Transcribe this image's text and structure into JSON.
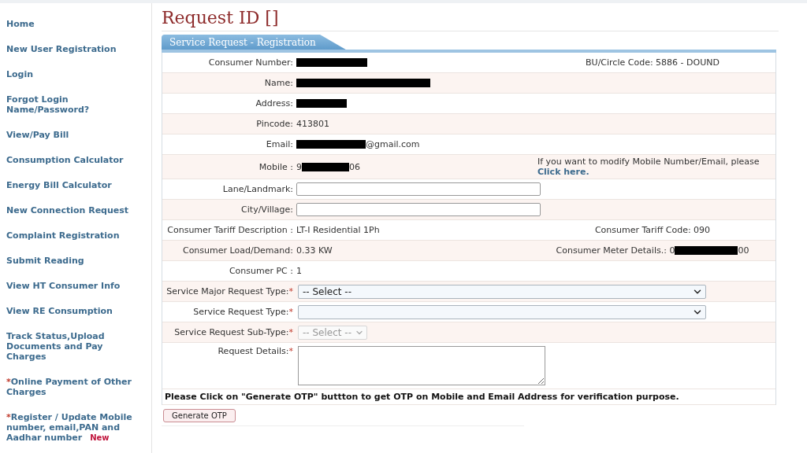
{
  "sidebar": {
    "items": [
      {
        "label": "Home"
      },
      {
        "label": "New User Registration"
      },
      {
        "label": "Login"
      },
      {
        "label": "Forgot Login Name/Password?"
      },
      {
        "label": "View/Pay Bill"
      },
      {
        "label": "Consumption Calculator"
      },
      {
        "label": "Energy Bill Calculator"
      },
      {
        "label": "New Connection Request"
      },
      {
        "label": "Complaint Registration"
      },
      {
        "label": "Submit Reading"
      },
      {
        "label": "View HT Consumer Info"
      },
      {
        "label": "View RE Consumption"
      },
      {
        "label": "Track Status,Upload Documents and Pay Charges"
      },
      {
        "mark": "*",
        "label": "Online Payment of Other Charges"
      },
      {
        "mark": "*",
        "label": "Register / Update Mobile number, email,PAN and Aadhar number",
        "badge": "New"
      }
    ]
  },
  "title": "Request ID []",
  "panel": {
    "tab": "Service Request - Registration",
    "rows": [
      {
        "kind": "text",
        "label": "Consumer Number:",
        "value": [
          {
            "kind": "redaction"
          }
        ],
        "aside": [
          {
            "kind": "text",
            "text": "BU/Circle Code: 5886 - DOUND"
          }
        ]
      },
      {
        "kind": "text",
        "label": "Name:",
        "value": [
          {
            "kind": "redaction"
          }
        ]
      },
      {
        "kind": "text",
        "label": "Address:",
        "value": [
          {
            "kind": "redaction"
          }
        ]
      },
      {
        "kind": "text",
        "label": "Pincode:",
        "value": [
          {
            "kind": "text",
            "text": "413801"
          }
        ]
      },
      {
        "kind": "text",
        "label": "Email:",
        "value": [
          {
            "kind": "redaction"
          },
          {
            "kind": "text",
            "text": "@gmail.com"
          }
        ]
      },
      {
        "kind": "text",
        "label": "Mobile :",
        "value": [
          {
            "kind": "text",
            "text": "9"
          },
          {
            "kind": "redaction"
          },
          {
            "kind": "text",
            "text": "06"
          }
        ],
        "note": {
          "text": "If you want to modify Mobile Number/Email, please",
          "link": "Click here."
        }
      },
      {
        "kind": "input",
        "label": "Lane/Landmark:"
      },
      {
        "kind": "input",
        "label": "City/Village:"
      },
      {
        "kind": "text",
        "label": "Consumer Tariff Description :",
        "value": [
          {
            "kind": "text",
            "text": "LT-I Residential 1Ph"
          }
        ],
        "aside": [
          {
            "kind": "text",
            "text": "Consumer Tariff Code: 090"
          }
        ]
      },
      {
        "kind": "text",
        "label": "Consumer Load/Demand:",
        "value": [
          {
            "kind": "text",
            "text": "0.33 KW"
          }
        ],
        "aside": [
          {
            "kind": "text",
            "text": "Consumer Meter Details.: 0"
          },
          {
            "kind": "redaction"
          },
          {
            "kind": "text",
            "text": "00"
          }
        ]
      },
      {
        "kind": "text",
        "label": "Consumer PC :",
        "value": [
          {
            "kind": "text",
            "text": "1"
          }
        ]
      },
      {
        "kind": "select",
        "label": "Service Major Request Type:",
        "required": "*",
        "value": "-- Select --",
        "disabled": false
      },
      {
        "kind": "select",
        "label": "Service Request Type:",
        "required": "*",
        "disabled": false
      },
      {
        "kind": "select",
        "label": "Service Request Sub-Type:",
        "required": "*",
        "value": "-- Select --",
        "disabled": true
      },
      {
        "kind": "textarea",
        "label": "Request Details:",
        "required": "*"
      }
    ],
    "notice": "Please Click on \"Generate OTP\" buttton to get OTP on Mobile and Email Address for verification purpose.",
    "button": "Generate OTP"
  }
}
